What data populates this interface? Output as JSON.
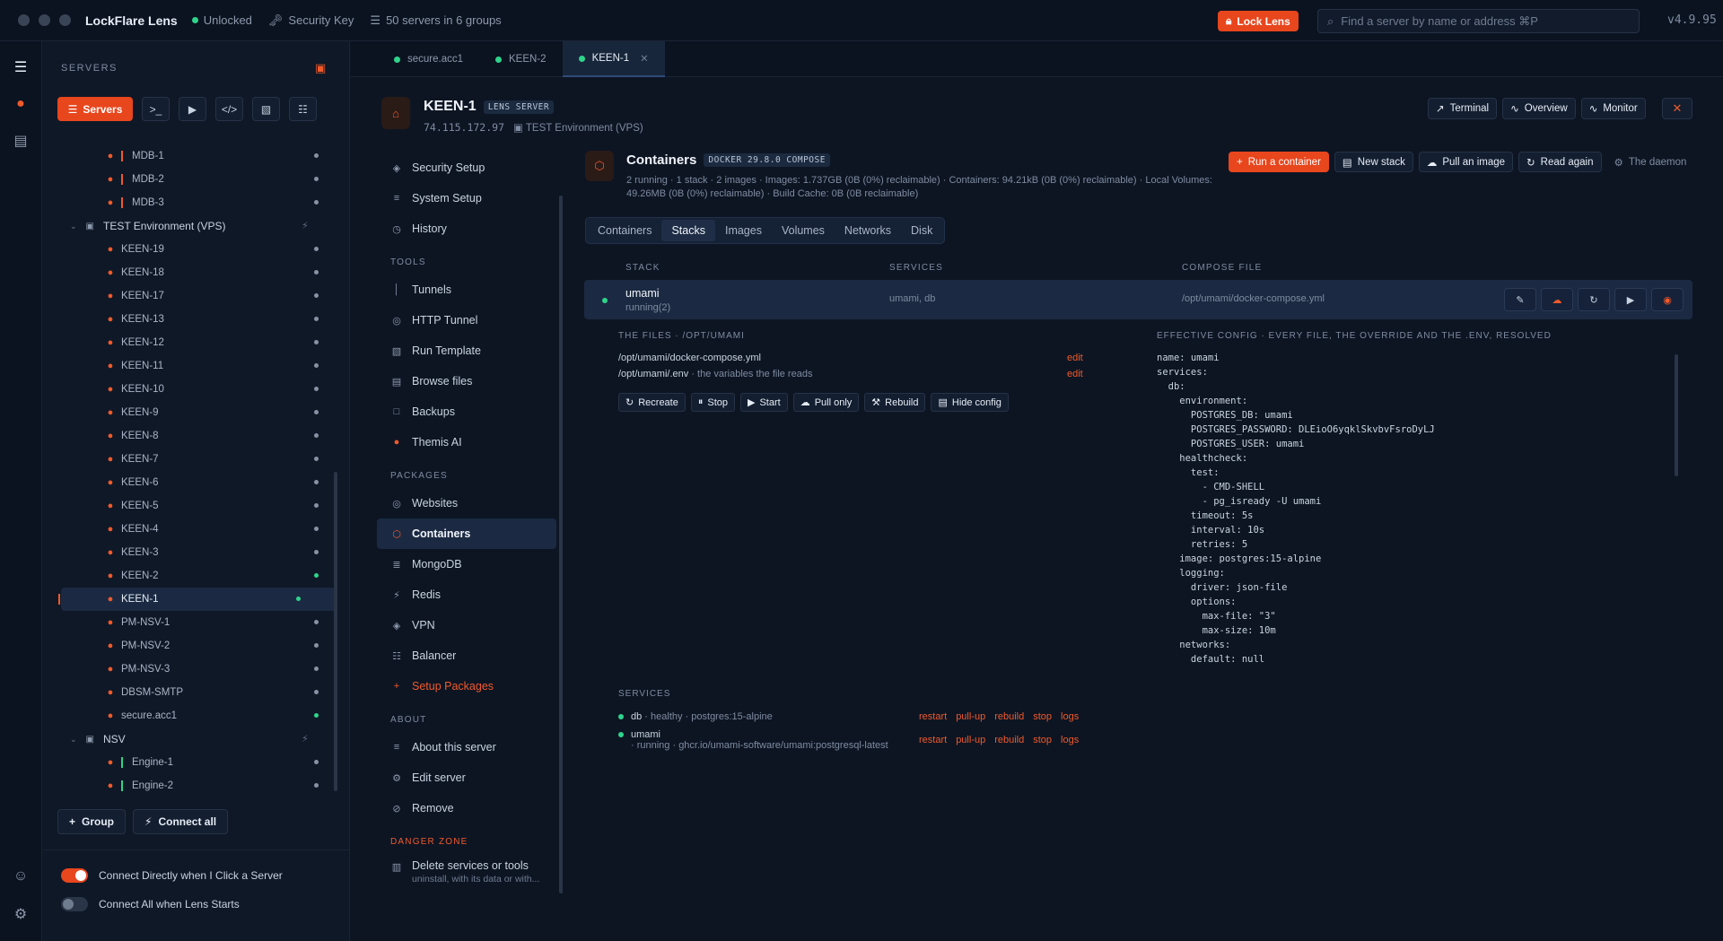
{
  "titlebar": {
    "app_name": "LockFlare Lens",
    "status": "Unlocked",
    "security_key": "Security Key",
    "servers_summary": "50 servers in 6 groups",
    "lock_button": "Lock Lens",
    "search_placeholder": "Find a server by name or address  ⌘P",
    "version": "v4.9.95"
  },
  "sidebar": {
    "heading": "SERVERS",
    "servers_button": "Servers",
    "tree": [
      {
        "label": "MDB-1",
        "kind": "server",
        "marker": "bar-red",
        "status": "grey"
      },
      {
        "label": "MDB-2",
        "kind": "server",
        "marker": "bar-red",
        "status": "grey"
      },
      {
        "label": "MDB-3",
        "kind": "server",
        "marker": "bar-red",
        "status": "grey"
      },
      {
        "label": "TEST Environment (VPS)",
        "kind": "group"
      },
      {
        "label": "KEEN-19",
        "kind": "server",
        "status": "grey"
      },
      {
        "label": "KEEN-18",
        "kind": "server",
        "status": "grey"
      },
      {
        "label": "KEEN-17",
        "kind": "server",
        "status": "grey"
      },
      {
        "label": "KEEN-13",
        "kind": "server",
        "status": "grey"
      },
      {
        "label": "KEEN-12",
        "kind": "server",
        "status": "grey"
      },
      {
        "label": "KEEN-11",
        "kind": "server",
        "status": "grey"
      },
      {
        "label": "KEEN-10",
        "kind": "server",
        "status": "grey"
      },
      {
        "label": "KEEN-9",
        "kind": "server",
        "status": "grey"
      },
      {
        "label": "KEEN-8",
        "kind": "server",
        "status": "grey"
      },
      {
        "label": "KEEN-7",
        "kind": "server",
        "status": "grey"
      },
      {
        "label": "KEEN-6",
        "kind": "server",
        "status": "grey"
      },
      {
        "label": "KEEN-5",
        "kind": "server",
        "status": "grey"
      },
      {
        "label": "KEEN-4",
        "kind": "server",
        "status": "grey"
      },
      {
        "label": "KEEN-3",
        "kind": "server",
        "status": "grey"
      },
      {
        "label": "KEEN-2",
        "kind": "server",
        "status": "green"
      },
      {
        "label": "KEEN-1",
        "kind": "server",
        "status": "green",
        "active": true
      },
      {
        "label": "PM-NSV-1",
        "kind": "server",
        "status": "grey"
      },
      {
        "label": "PM-NSV-2",
        "kind": "server",
        "status": "grey"
      },
      {
        "label": "PM-NSV-3",
        "kind": "server",
        "status": "grey"
      },
      {
        "label": "DBSM-SMTP",
        "kind": "server",
        "status": "grey"
      },
      {
        "label": "secure.acc1",
        "kind": "server",
        "status": "green"
      },
      {
        "label": "NSV",
        "kind": "group"
      },
      {
        "label": "Engine-1",
        "kind": "server",
        "marker": "bar-green",
        "status": "grey"
      },
      {
        "label": "Engine-2",
        "kind": "server",
        "marker": "bar-green",
        "status": "grey"
      }
    ],
    "group_button": "Group",
    "connect_all_button": "Connect all",
    "toggle_connect_direct": "Connect Directly when I Click a Server",
    "toggle_connect_all": "Connect All when Lens Starts"
  },
  "tabs": [
    {
      "label": "secure.acc1",
      "active": false
    },
    {
      "label": "KEEN-2",
      "active": false
    },
    {
      "label": "KEEN-1",
      "active": true
    }
  ],
  "server": {
    "name": "KEEN-1",
    "badge": "LENS SERVER",
    "ip": "74.115.172.97",
    "group": "TEST Environment (VPS)",
    "actions": {
      "terminal": "Terminal",
      "overview": "Overview",
      "monitor": "Monitor"
    }
  },
  "nav": {
    "security_setup": "Security Setup",
    "system_setup": "System Setup",
    "history": "History",
    "tools_heading": "TOOLS",
    "tunnels": "Tunnels",
    "http_tunnel": "HTTP Tunnel",
    "run_template": "Run Template",
    "browse_files": "Browse files",
    "backups": "Backups",
    "themis_ai": "Themis AI",
    "packages_heading": "PACKAGES",
    "websites": "Websites",
    "containers": "Containers",
    "mongodb": "MongoDB",
    "redis": "Redis",
    "vpn": "VPN",
    "balancer": "Balancer",
    "setup_packages": "Setup Packages",
    "about_heading": "ABOUT",
    "about_server": "About this server",
    "edit_server": "Edit server",
    "remove": "Remove",
    "danger_heading": "DANGER ZONE",
    "delete_services": "Delete services or tools",
    "delete_services_sub": "uninstall, with its data or with..."
  },
  "containers": {
    "title": "Containers",
    "badge": "DOCKER 29.8.0 COMPOSE",
    "description": "2 running · 1 stack · 2 images · Images: 1.737GB (0B (0%) reclaimable) · Containers: 94.21kB (0B (0%) reclaimable) · Local Volumes: 49.26MB (0B (0%) reclaimable) · Build Cache: 0B (0B reclaimable)",
    "run_container": "Run a container",
    "new_stack": "New stack",
    "pull_image": "Pull an image",
    "read_again": "Read again",
    "daemon": "The daemon",
    "subtabs": [
      "Containers",
      "Stacks",
      "Images",
      "Volumes",
      "Networks",
      "Disk"
    ],
    "active_subtab": "Stacks",
    "columns": {
      "stack": "STACK",
      "services": "SERVICES",
      "compose": "COMPOSE FILE"
    },
    "stack": {
      "name": "umami",
      "state": "running(2)",
      "services": "umami, db",
      "compose_file": "/opt/umami/docker-compose.yml"
    },
    "files_heading": "THE FILES · /OPT/UMAMI",
    "files": [
      {
        "path": "/opt/umami/docker-compose.yml",
        "note": "",
        "edit": "edit"
      },
      {
        "path": "/opt/umami/.env",
        "note": " · the variables the file reads",
        "edit": "edit"
      }
    ],
    "stack_actions": {
      "recreate": "Recreate",
      "stop": "Stop",
      "start": "Start",
      "pull_only": "Pull only",
      "rebuild": "Rebuild",
      "hide_config": "Hide config"
    },
    "config_heading": "EFFECTIVE CONFIG · EVERY FILE, THE OVERRIDE AND THE .ENV, RESOLVED",
    "config_lines": [
      "name: umami",
      "services:",
      "  db:",
      "    environment:",
      "      POSTGRES_DB: umami",
      "      POSTGRES_PASSWORD: DLEioO6yqklSkvbvFsroDyLJ",
      "      POSTGRES_USER: umami",
      "    healthcheck:",
      "      test:",
      "        - CMD-SHELL",
      "        - pg_isready -U umami",
      "      timeout: 5s",
      "      interval: 10s",
      "      retries: 5",
      "    image: postgres:15-alpine",
      "    logging:",
      "      driver: json-file",
      "      options:",
      "        max-file: \"3\"",
      "        max-size: 10m",
      "    networks:",
      "      default: null"
    ],
    "services_heading": "SERVICES",
    "services_list": [
      {
        "name": "db",
        "meta": " · healthy · postgres:15-alpine"
      },
      {
        "name": "umami",
        "meta": "· running · ghcr.io/umami-software/umami:postgresql-latest"
      }
    ],
    "service_links": {
      "restart": "restart",
      "pull_up": "pull-up",
      "rebuild": "rebuild",
      "stop": "stop",
      "logs": "logs"
    }
  }
}
